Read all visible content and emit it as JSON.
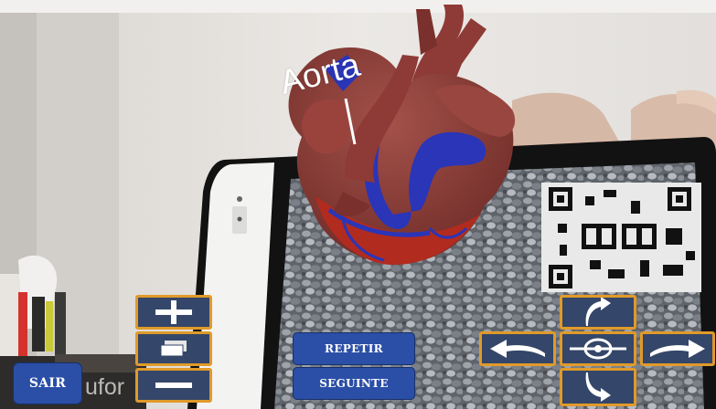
{
  "ar_label": {
    "text": "Aorta"
  },
  "watermark": {
    "text": "ufor"
  },
  "controls": {
    "exit_label": "SAIR",
    "repeat_label": "REPETIR",
    "next_label": "SEGUINTE",
    "zoom_in_icon": "plus-icon",
    "layer_icon": "layers-icon",
    "zoom_out_icon": "minus-icon",
    "rotate_up_icon": "curved-arrow-up-icon",
    "rotate_down_icon": "curved-arrow-down-icon",
    "rotate_left_icon": "curved-arrow-left-icon",
    "rotate_right_icon": "curved-arrow-right-icon",
    "center_icon": "crosshair-icon"
  },
  "colors": {
    "button_fill": "#344669",
    "button_border": "#e09a2a",
    "text_button_fill": "#2b4fa6",
    "heart_muscle": "#8b3a35",
    "vein_blue": "#2a35b8",
    "artery_red": "#b12b1f"
  }
}
